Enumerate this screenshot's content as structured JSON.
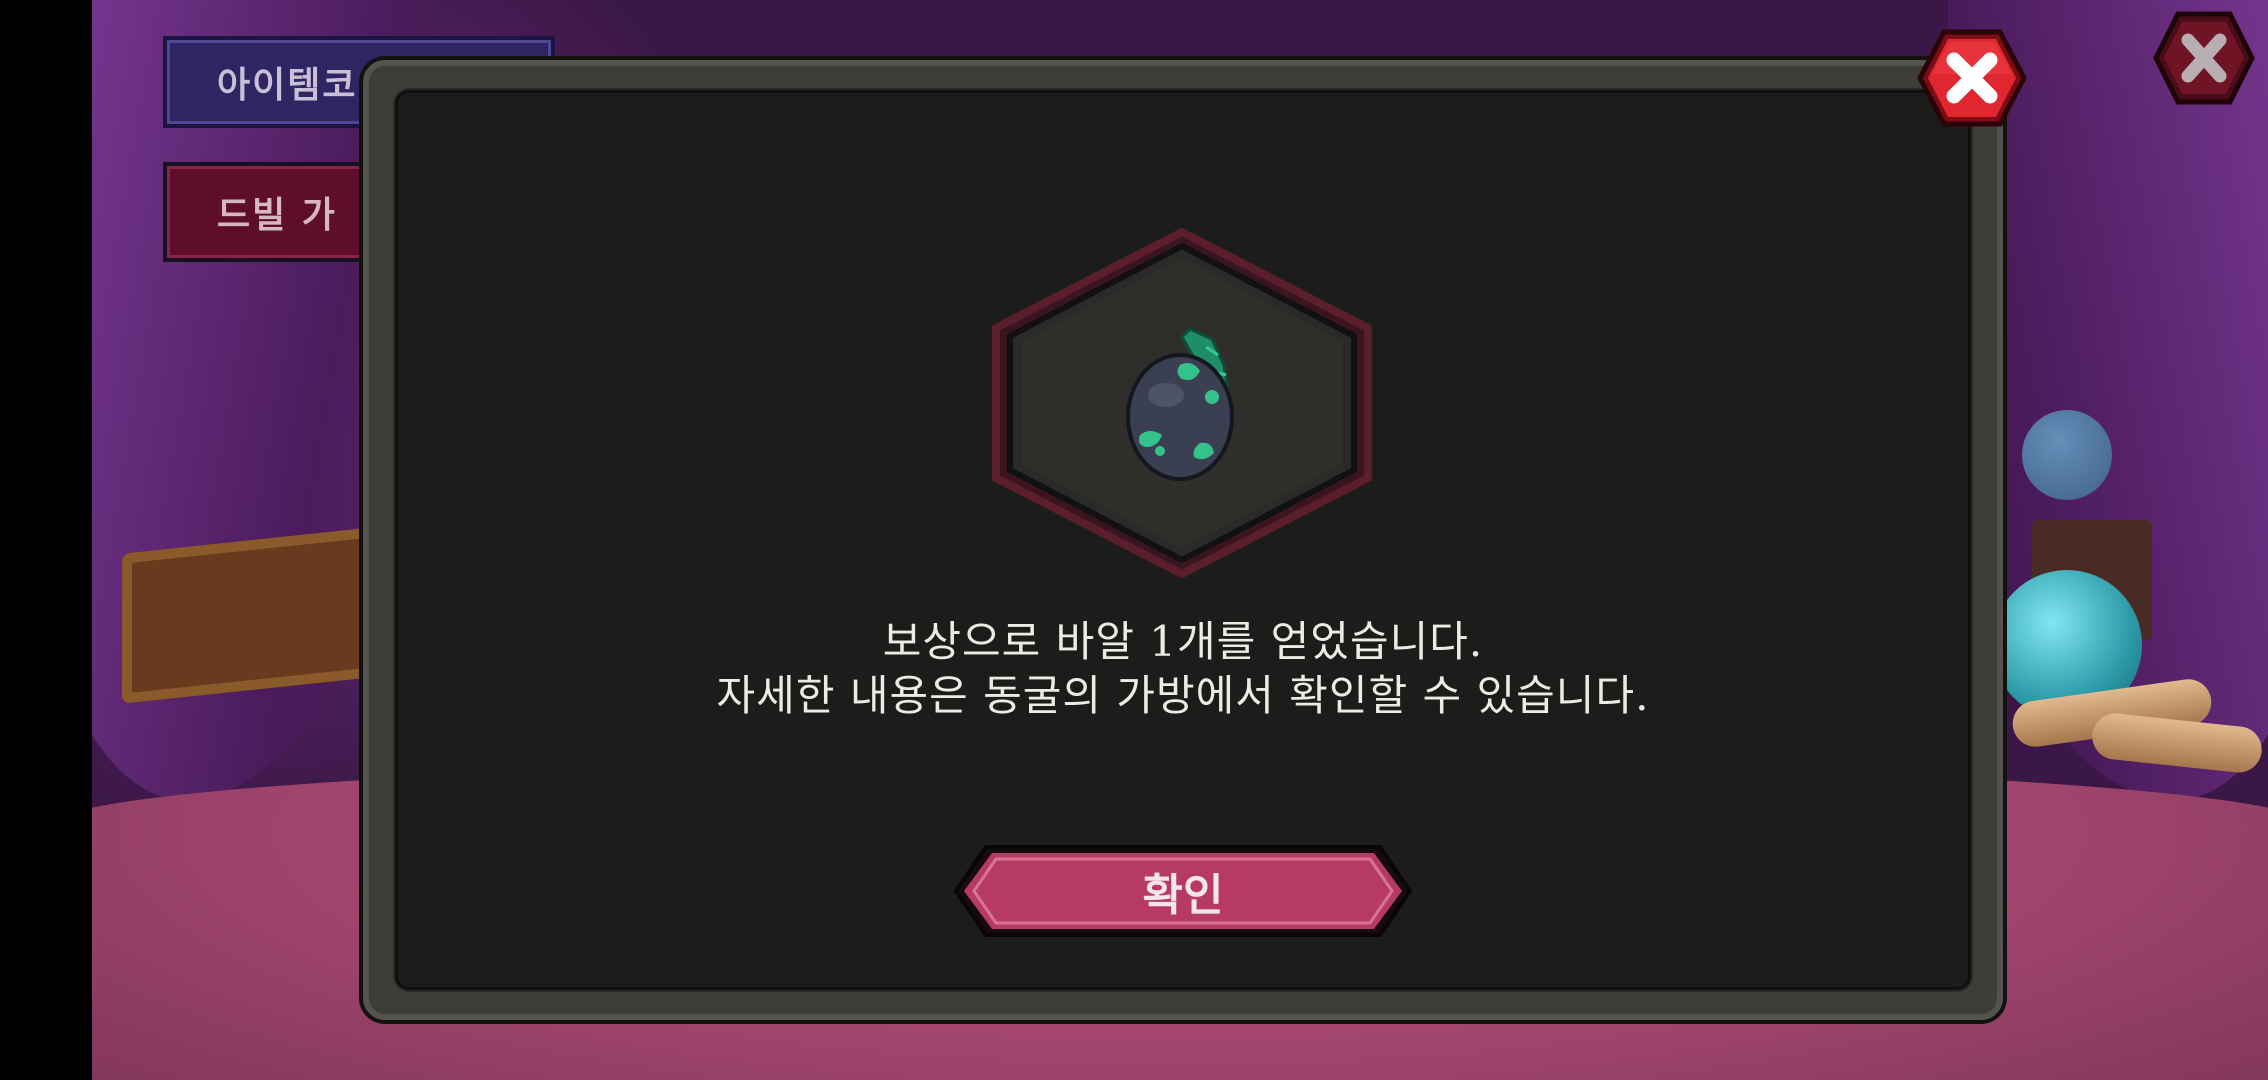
{
  "background": {
    "side_buttons": [
      {
        "label": "아이템코"
      },
      {
        "label": "드빌 가"
      }
    ]
  },
  "modal": {
    "reward_item_icon": "blue-dragon-egg-icon",
    "message_line1": "보상으로 바알 1개를 얻었습니다.",
    "message_line2": "자세한 내용은 동굴의 가방에서 확인할 수 있습니다.",
    "confirm_label": "확인"
  },
  "colors": {
    "confirm_button": "#b73a62",
    "close_button": "#d4202c",
    "hex_frame": "#5a1e2e"
  }
}
